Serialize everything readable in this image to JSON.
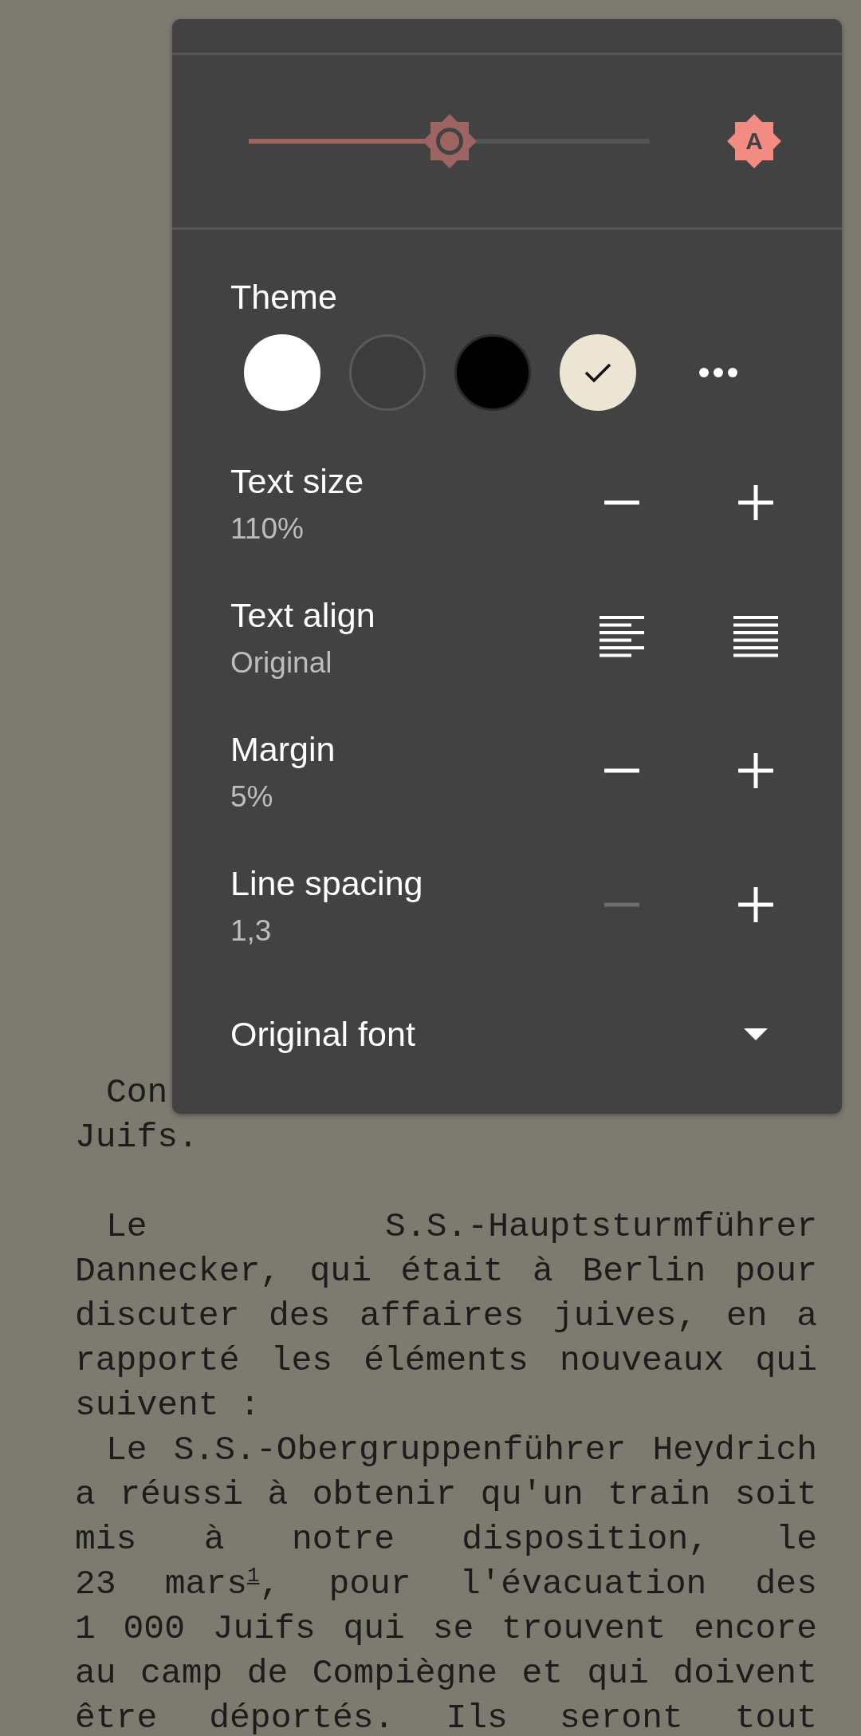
{
  "page": {
    "lines": [
      {
        "text": "Con",
        "indent": true,
        "justify": false
      },
      {
        "text": "Juifs.",
        "indent": false,
        "justify": false,
        "gap_after": true
      },
      {
        "text": "Le S.S.-Hauptsturmführer",
        "indent": true,
        "justify": true
      },
      {
        "text": "Dannecker, qui était à Berlin pour",
        "indent": false,
        "justify": true
      },
      {
        "text": "discuter des affaires juives, en a",
        "indent": false,
        "justify": true
      },
      {
        "text": "rapporté les éléments nouveaux qui",
        "indent": false,
        "justify": true
      },
      {
        "text": "suivent :",
        "indent": false,
        "justify": false
      },
      {
        "text": "Le S.S.-Obergruppenführer Heydrich",
        "indent": true,
        "justify": true
      },
      {
        "text": "a réussi à obtenir qu'un train soit",
        "indent": false,
        "justify": true
      },
      {
        "text": "mis à notre disposition, le",
        "indent": false,
        "justify": true
      },
      {
        "text": "23 mars$^{1}$, pour l'évacuation des",
        "indent": false,
        "justify": true
      },
      {
        "text": "1 000 Juifs qui se trouvent encore",
        "indent": false,
        "justify": true
      },
      {
        "text": "au camp de Compiègne et qui doivent",
        "indent": false,
        "justify": true
      },
      {
        "text": "être déportés. Ils seront tout",
        "indent": false,
        "justify": true
      }
    ]
  },
  "brightness": {
    "level": 0.5,
    "auto": true,
    "auto_icon_text": "A"
  },
  "theme": {
    "label": "Theme",
    "options": [
      {
        "color": "#ffffff",
        "selected": false
      },
      {
        "color": "#3c3c3c",
        "selected": false
      },
      {
        "color": "#000000",
        "selected": false
      },
      {
        "color": "#ede5d4",
        "selected": true
      }
    ]
  },
  "settings": [
    {
      "kind": "stepper",
      "label": "Text size",
      "value": "110%",
      "decrease_disabled": false
    },
    {
      "kind": "align",
      "label": "Text align",
      "value": "Original"
    },
    {
      "kind": "stepper",
      "label": "Margin",
      "value": "5%",
      "decrease_disabled": false
    },
    {
      "kind": "stepper",
      "label": "Line spacing",
      "value": "1,3",
      "decrease_disabled": true
    }
  ],
  "font": {
    "label": "Original font"
  }
}
